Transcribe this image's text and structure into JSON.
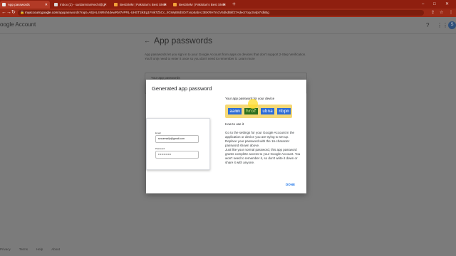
{
  "browser": {
    "tabs": [
      {
        "title": "App passwords",
        "favicon_color": "#e8e8e8",
        "active": true
      },
      {
        "title": "Inbox (2) - sardarmianNechi@g",
        "favicon_color": "#d9d9d9",
        "active": false
      },
      {
        "title": "BestSMM | Pakistan's Best SMM",
        "favicon_color": "#f2a23a",
        "active": false
      },
      {
        "title": "BestSMM | Pakistan's Best SMM",
        "favicon_color": "#f2a23a",
        "active": false
      }
    ],
    "new_tab": "+",
    "window_controls": [
      "–",
      "□",
      "✕"
    ],
    "address": {
      "host": "myaccount.google.com",
      "path": "/apppasswords?rapt=AEjHL4NRsh4dewRM7vPRL-UHET1lkEg1FNk7ZbCc_hGWyB8dSDr7xnp5abAz3BXRH7m1V5dkdBkf27AdecI7oqcSvlpi7rdkBg"
    },
    "nav_icons": [
      "←",
      "→",
      "↻"
    ]
  },
  "header": {
    "logo_text": "oogle Account",
    "avatar_letter": "S"
  },
  "page": {
    "title": "App passwords",
    "intro": "App passwords let you sign in to your Google Account from apps on devices that don't support 2-Step Verification. You'll only need to enter it once so you don't need to remember it.",
    "learn_more": "Learn more",
    "card_label": "Your app passwords"
  },
  "footer": {
    "links": [
      "Privacy",
      "Terms",
      "Help",
      "About"
    ]
  },
  "dialog": {
    "title": "Generated app password",
    "preview": {
      "email_label": "Email",
      "email_value": "securesally@gmail.com",
      "password_label": "Password",
      "password_value": "••••••••••••"
    },
    "password_heading": "Your app password for your device",
    "password_chunks": [
      "aamm",
      "hrof",
      "ubna",
      "nbpm"
    ],
    "howto_heading": "How to use it",
    "instructions": "Go to the settings for your Google Account in the application or device you are trying to set up. Replace your password with the 16-character password shown above.\nJust like your normal password, this app password grants complete access to your Google Account. You won't need to remember it, so don't write it down or share it with anyone.",
    "done_label": "DONE"
  },
  "colors": {
    "tab_bar": "#8f1f0f",
    "address_bar": "#9b2a17",
    "overlay": "#7b7b7b",
    "password_bg": "#f5d875",
    "link_blue": "#1a73e8"
  }
}
